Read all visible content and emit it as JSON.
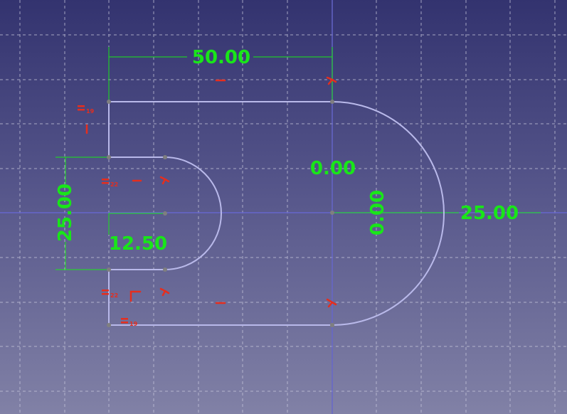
{
  "viewport": {
    "name": "sketcher-3d-view",
    "colors": {
      "background_top": "#33336f",
      "background_bottom": "#8181a6",
      "grid": "#c8c8dc",
      "axis": "#6666cc",
      "geometry": "#b9b9ea",
      "vertex": "#7f7f7f",
      "dimension": "#19e619",
      "constraint": "#e52e1e"
    }
  },
  "dimensions": {
    "top_length": "50.00",
    "origin_x": "0.00",
    "origin_y": "0.00",
    "outer_radius": "25.00",
    "inner_height": "25.00",
    "inner_radius": "12.50"
  },
  "constraints": {
    "equal_19_top": "19",
    "equal_22_mid": "22",
    "equal_22_low": "22",
    "equal_19_bottom": "19"
  }
}
